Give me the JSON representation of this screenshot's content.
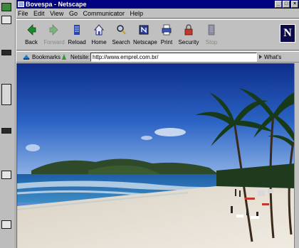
{
  "window": {
    "title": "Bovespa - Netscape",
    "minimize_glyph": "_",
    "maximize_glyph": "□",
    "close_glyph": "×"
  },
  "menu": {
    "items": [
      "File",
      "Edit",
      "View",
      "Go",
      "Communicator",
      "Help"
    ]
  },
  "toolbar": {
    "buttons": [
      {
        "label": "Back",
        "icon": "back-arrow-icon",
        "enabled": true
      },
      {
        "label": "Forward",
        "icon": "forward-arrow-icon",
        "enabled": false
      },
      {
        "label": "Reload",
        "icon": "reload-icon",
        "enabled": true
      },
      {
        "label": "Home",
        "icon": "home-icon",
        "enabled": true
      },
      {
        "label": "Search",
        "icon": "search-icon",
        "enabled": true
      },
      {
        "label": "Netscape",
        "icon": "netscape-icon",
        "enabled": true
      },
      {
        "label": "Print",
        "icon": "print-icon",
        "enabled": true
      },
      {
        "label": "Security",
        "icon": "security-lock-icon",
        "enabled": true
      },
      {
        "label": "Stop",
        "icon": "stop-icon",
        "enabled": false
      }
    ],
    "logo": "N"
  },
  "location": {
    "bookmarks_label": "Bookmarks",
    "netsite_label": "Netsite:",
    "url": "http://www.emprel.com.br/",
    "whats_related_label": "What's Related"
  },
  "colors": {
    "titlebar": "#000080",
    "chrome": "#c0c0c0",
    "sky": "#1f4fb8",
    "sea": "#1e6fb0",
    "sand": "#e8e2d6"
  }
}
